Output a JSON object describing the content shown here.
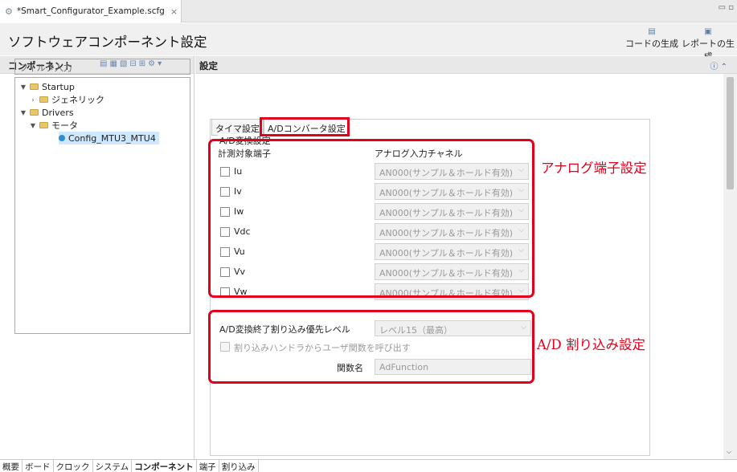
{
  "editor_tab": {
    "title": "*Smart_Configurator_Example.scfg",
    "close": "×"
  },
  "window_controls": "▭ ▫",
  "header": {
    "title": "ソフトウェアコンポーネント設定",
    "generate_code": "コードの生成",
    "generate_report": "レポートの生成"
  },
  "components_pane": {
    "title": "コンポーネント",
    "filter_placeholder": "フィルタ入力",
    "tree": [
      {
        "label": "Startup",
        "expanded": true
      },
      {
        "label": "ジェネリック",
        "expanded": false
      },
      {
        "label": "Drivers",
        "expanded": true
      },
      {
        "label": "モータ",
        "expanded": true
      },
      {
        "label": "Config_MTU3_MTU4",
        "selected": true
      }
    ]
  },
  "settings_pane": {
    "title": "設定",
    "tabs": [
      "タイマ設定",
      "A/Dコンバータ設定"
    ],
    "ad_group": {
      "title": "A/D変換設定",
      "col_pin": "計測対象端子",
      "col_channel": "アナログ入力チャネル",
      "rows": [
        {
          "pin": "Iu",
          "channel": "AN000(サンプル＆ホールド有効)"
        },
        {
          "pin": "Iv",
          "channel": "AN000(サンプル＆ホールド有効)"
        },
        {
          "pin": "Iw",
          "channel": "AN000(サンプル＆ホールド有効)"
        },
        {
          "pin": "Vdc",
          "channel": "AN000(サンプル＆ホールド有効)"
        },
        {
          "pin": "Vu",
          "channel": "AN000(サンプル＆ホールド有効)"
        },
        {
          "pin": "Vv",
          "channel": "AN000(サンプル＆ホールド有効)"
        },
        {
          "pin": "Vw",
          "channel": "AN000(サンプル＆ホールド有効)"
        }
      ]
    },
    "interrupt": {
      "priority_label": "A/D変換終了割り込み優先レベル",
      "priority_value": "レベル15（最高）",
      "callback_label": "割り込みハンドラからユーザ関数を呼び出す",
      "function_label": "関数名",
      "function_value": "AdFunction"
    }
  },
  "annotations": {
    "analog": "アナログ端子設定",
    "interrupt": "A/D 割り込み設定"
  },
  "bottom_tabs": [
    "概要",
    "ボード",
    "クロック",
    "システム",
    "コンポーネント",
    "端子",
    "割り込み"
  ],
  "colors": {
    "annotation_red": "#e3001b",
    "selection": "#cde8ff"
  }
}
